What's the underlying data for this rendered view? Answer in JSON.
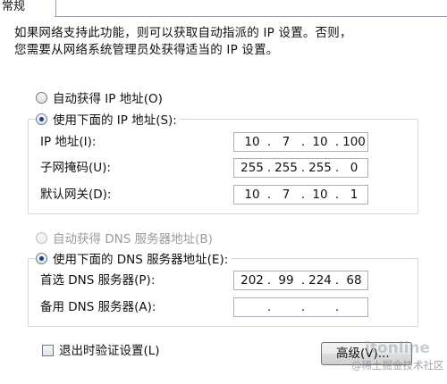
{
  "tab": {
    "label": "常规"
  },
  "description": {
    "line1": "如果网络支持此功能，则可以获取自动指派的 IP 设置。否则，",
    "line2": "您需要从网络系统管理员处获得适当的 IP 设置。"
  },
  "ip": {
    "auto_label": "自动获得 IP 地址(O)",
    "manual_label": "使用下面的 IP 地址(S):",
    "mode": "manual",
    "fields": [
      {
        "label": "IP 地址(I):",
        "octets": [
          "10",
          "7",
          "10",
          "100"
        ]
      },
      {
        "label": "子网掩码(U):",
        "octets": [
          "255",
          "255",
          "255",
          "0"
        ]
      },
      {
        "label": "默认网关(D):",
        "octets": [
          "10",
          "7",
          "10",
          "1"
        ]
      }
    ]
  },
  "dns": {
    "auto_label": "自动获得 DNS 服务器地址(B)",
    "manual_label": "使用下面的 DNS 服务器地址(E):",
    "mode": "manual",
    "fields": [
      {
        "label": "首选 DNS 服务器(P):",
        "octets": [
          "202",
          "99",
          "224",
          "68"
        ]
      },
      {
        "label": "备用 DNS 服务器(A):",
        "octets": [
          "",
          "",
          "",
          ""
        ]
      }
    ]
  },
  "validate_on_exit": {
    "label": "退出时验证设置(L)",
    "checked": false
  },
  "advanced_button": {
    "label": "高级(V)..."
  },
  "watermark": {
    "line1": "itonline",
    "line2": "@稀土掘金技术社区"
  }
}
